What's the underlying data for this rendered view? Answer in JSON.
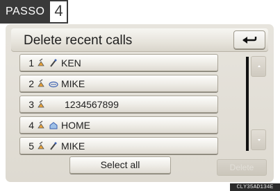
{
  "step": {
    "label": "PASSO",
    "number": "4"
  },
  "screen": {
    "title": "Delete recent calls",
    "back_icon": "return-arrow-icon",
    "rows": [
      {
        "index": "1",
        "status_icon": "outgoing-call-icon",
        "type_icon": "mobile-phone-icon",
        "name": "KEN"
      },
      {
        "index": "2",
        "status_icon": "outgoing-call-icon",
        "type_icon": "phone-handset-icon",
        "name": "MIKE"
      },
      {
        "index": "3",
        "status_icon": "outgoing-call-icon",
        "type_icon": "",
        "name": "1234567899"
      },
      {
        "index": "4",
        "status_icon": "outgoing-call-icon",
        "type_icon": "home-phone-icon",
        "name": "HOME"
      },
      {
        "index": "5",
        "status_icon": "outgoing-call-icon",
        "type_icon": "mobile-phone-icon",
        "name": "MIKE"
      }
    ],
    "select_all_label": "Select all",
    "delete_label": "Delete",
    "scroll_up_icon": "scroll-up-icon",
    "scroll_down_icon": "scroll-down-icon"
  },
  "figure_code": "CLY35AD134E",
  "colors": {
    "badge": "#3a3a3a",
    "panel": "#e2dfd8",
    "button_border": "#a8a396",
    "scrollbar": "#111111"
  }
}
